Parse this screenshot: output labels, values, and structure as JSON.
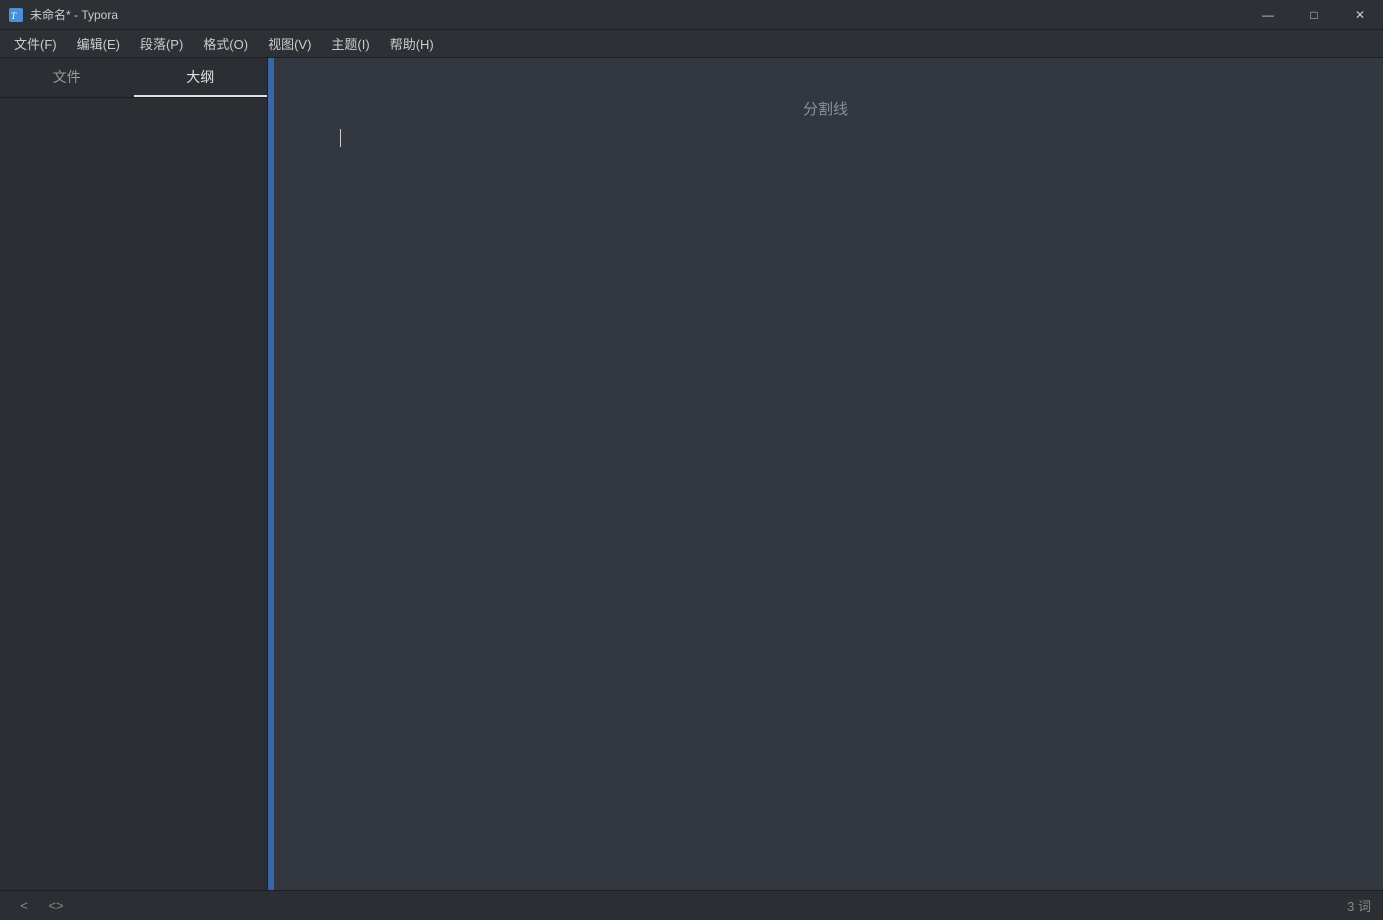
{
  "titlebar": {
    "icon_label": "T",
    "title": "未命名* - Typora",
    "minimize_label": "—",
    "maximize_label": "□",
    "close_label": "✕"
  },
  "menubar": {
    "items": [
      {
        "id": "file",
        "label": "文件(F)"
      },
      {
        "id": "edit",
        "label": "编辑(E)"
      },
      {
        "id": "paragraph",
        "label": "段落(P)"
      },
      {
        "id": "format",
        "label": "格式(O)"
      },
      {
        "id": "view",
        "label": "视图(V)"
      },
      {
        "id": "theme",
        "label": "主题(I)"
      },
      {
        "id": "help",
        "label": "帮助(H)"
      }
    ]
  },
  "sidebar": {
    "tabs": [
      {
        "id": "files",
        "label": "文件"
      },
      {
        "id": "outline",
        "label": "大纲",
        "active": true
      }
    ]
  },
  "editor": {
    "divider_text": "分割线"
  },
  "statusbar": {
    "word_count_label": "3 词",
    "left_arrow": "‹",
    "code_icon": "<>"
  }
}
